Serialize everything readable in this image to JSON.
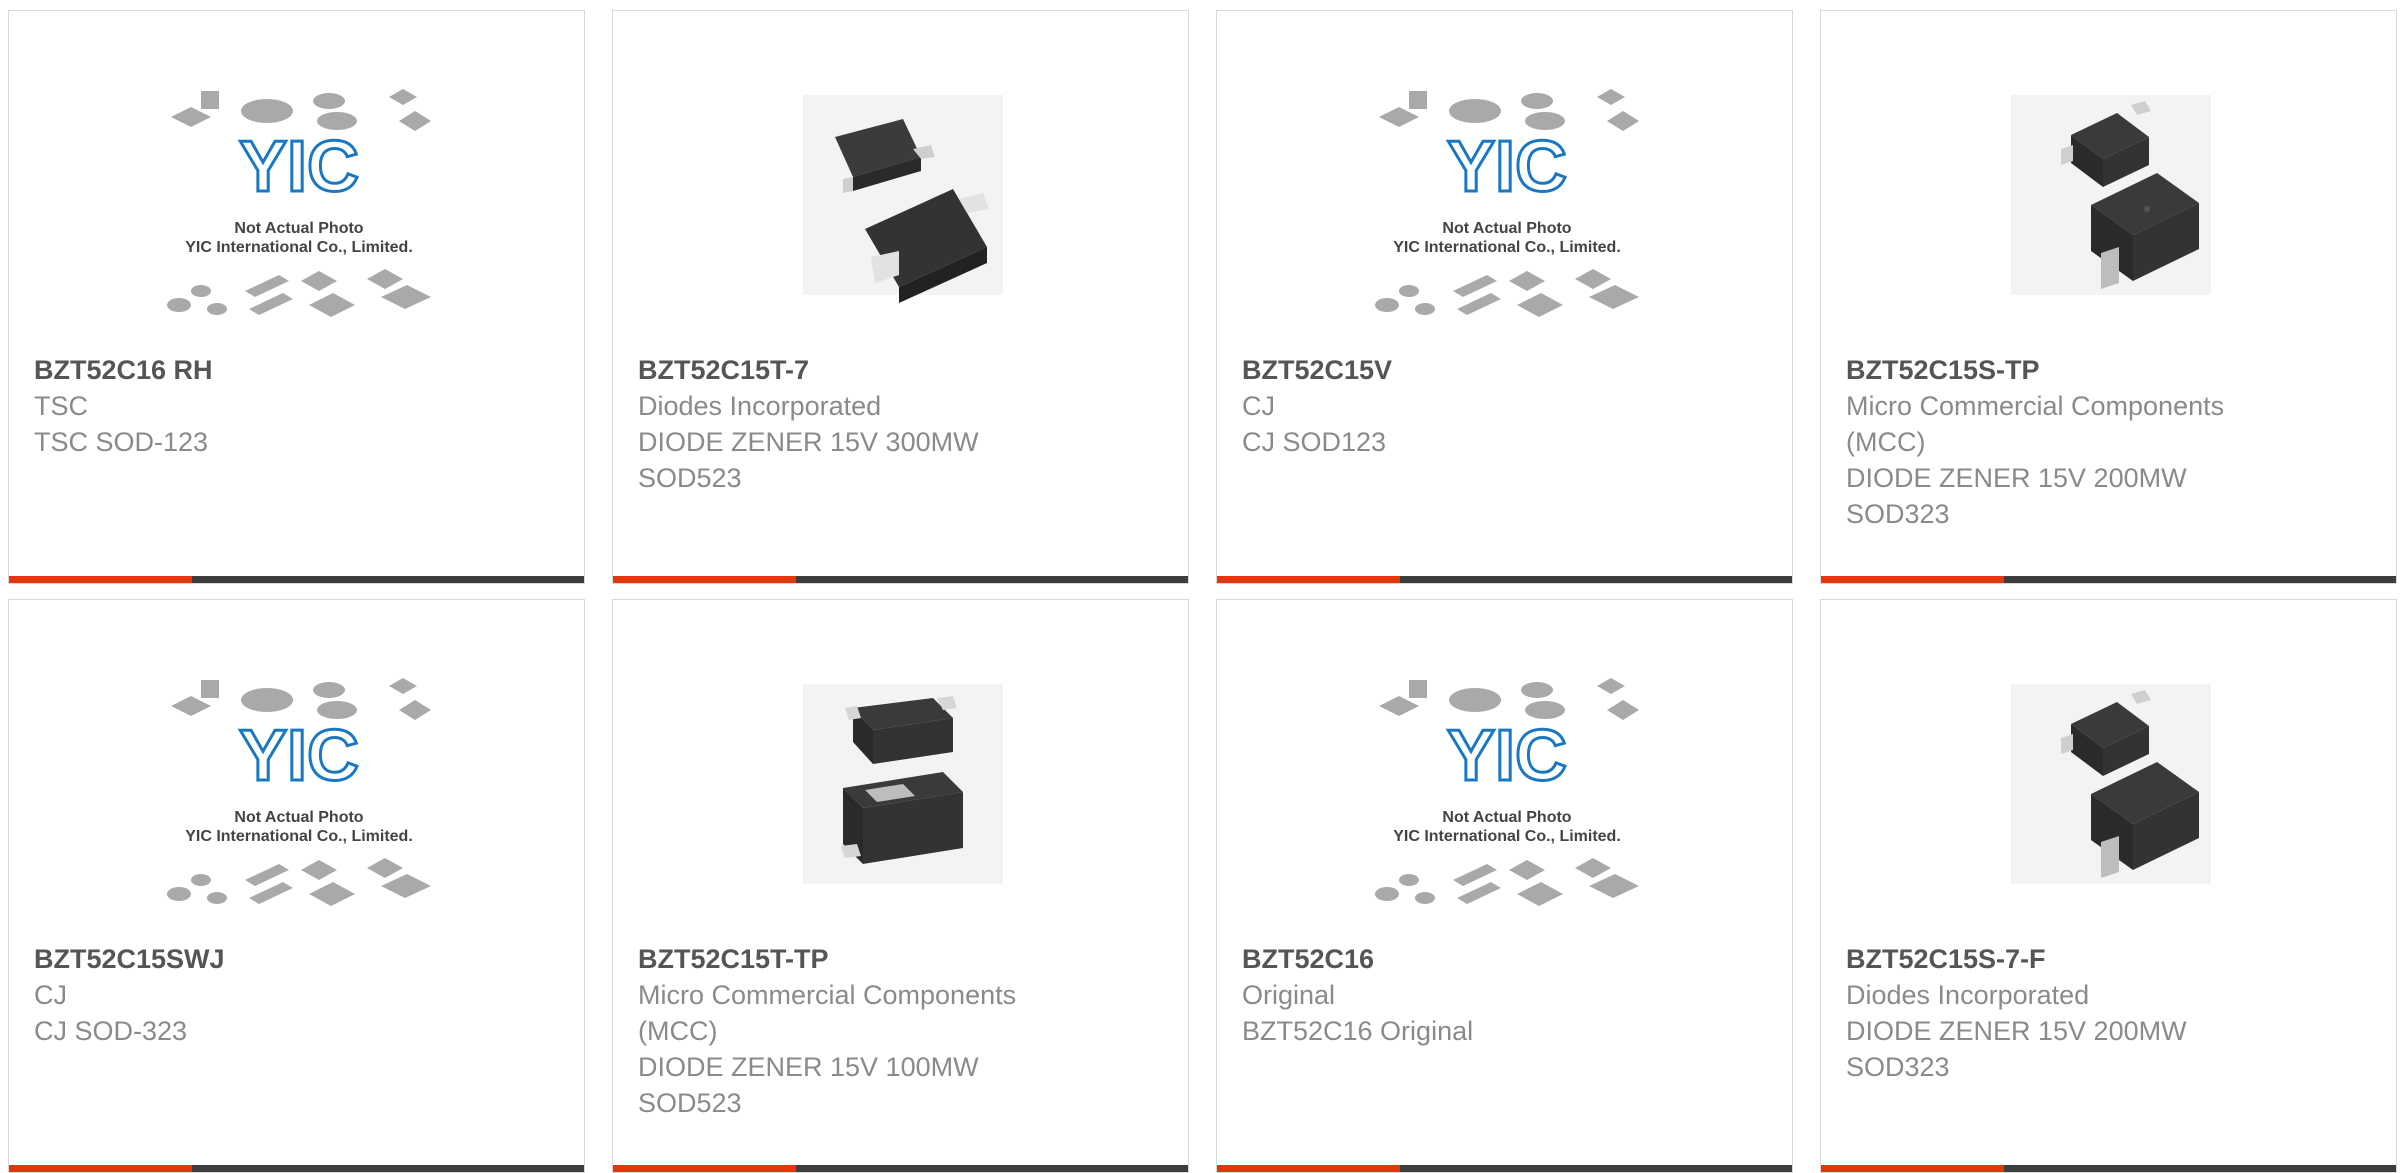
{
  "products": [
    {
      "part": "BZT52C16 RH",
      "manufacturer": "TSC",
      "description": "TSC SOD-123",
      "image": "yic-placeholder"
    },
    {
      "part": "BZT52C15T-7",
      "manufacturer": "Diodes Incorporated",
      "description": "DIODE ZENER 15V 300MW SOD523",
      "image": "sod523-photo"
    },
    {
      "part": "BZT52C15V",
      "manufacturer": "CJ",
      "description": "CJ SOD123",
      "image": "yic-placeholder"
    },
    {
      "part": "BZT52C15S-TP",
      "manufacturer": "Micro Commercial Components (MCC)",
      "description": "DIODE ZENER 15V 200MW SOD323",
      "image": "sod323-photo"
    },
    {
      "part": "BZT52C15SWJ",
      "manufacturer": "CJ",
      "description": "CJ SOD-323",
      "image": "yic-placeholder"
    },
    {
      "part": "BZT52C15T-TP",
      "manufacturer": "Micro Commercial Components (MCC)",
      "description": "DIODE ZENER 15V 100MW SOD523",
      "image": "sod523-photo"
    },
    {
      "part": "BZT52C16",
      "manufacturer": "Original",
      "description": "BZT52C16 Original",
      "image": "yic-placeholder"
    },
    {
      "part": "BZT52C15S-7-F",
      "manufacturer": "Diodes Incorporated",
      "description": "DIODE ZENER 15V 200MW SOD323",
      "image": "sod323-photo"
    }
  ],
  "placeholder": {
    "logo_text": "YIC",
    "line1": "Not Actual Photo",
    "line2": "YIC International Co., Limited."
  },
  "colors": {
    "accent": "#e2360b",
    "bar": "#3d3d3d",
    "logo_blue": "#1a78c2",
    "title": "#555555",
    "text": "#8a8a8a"
  }
}
